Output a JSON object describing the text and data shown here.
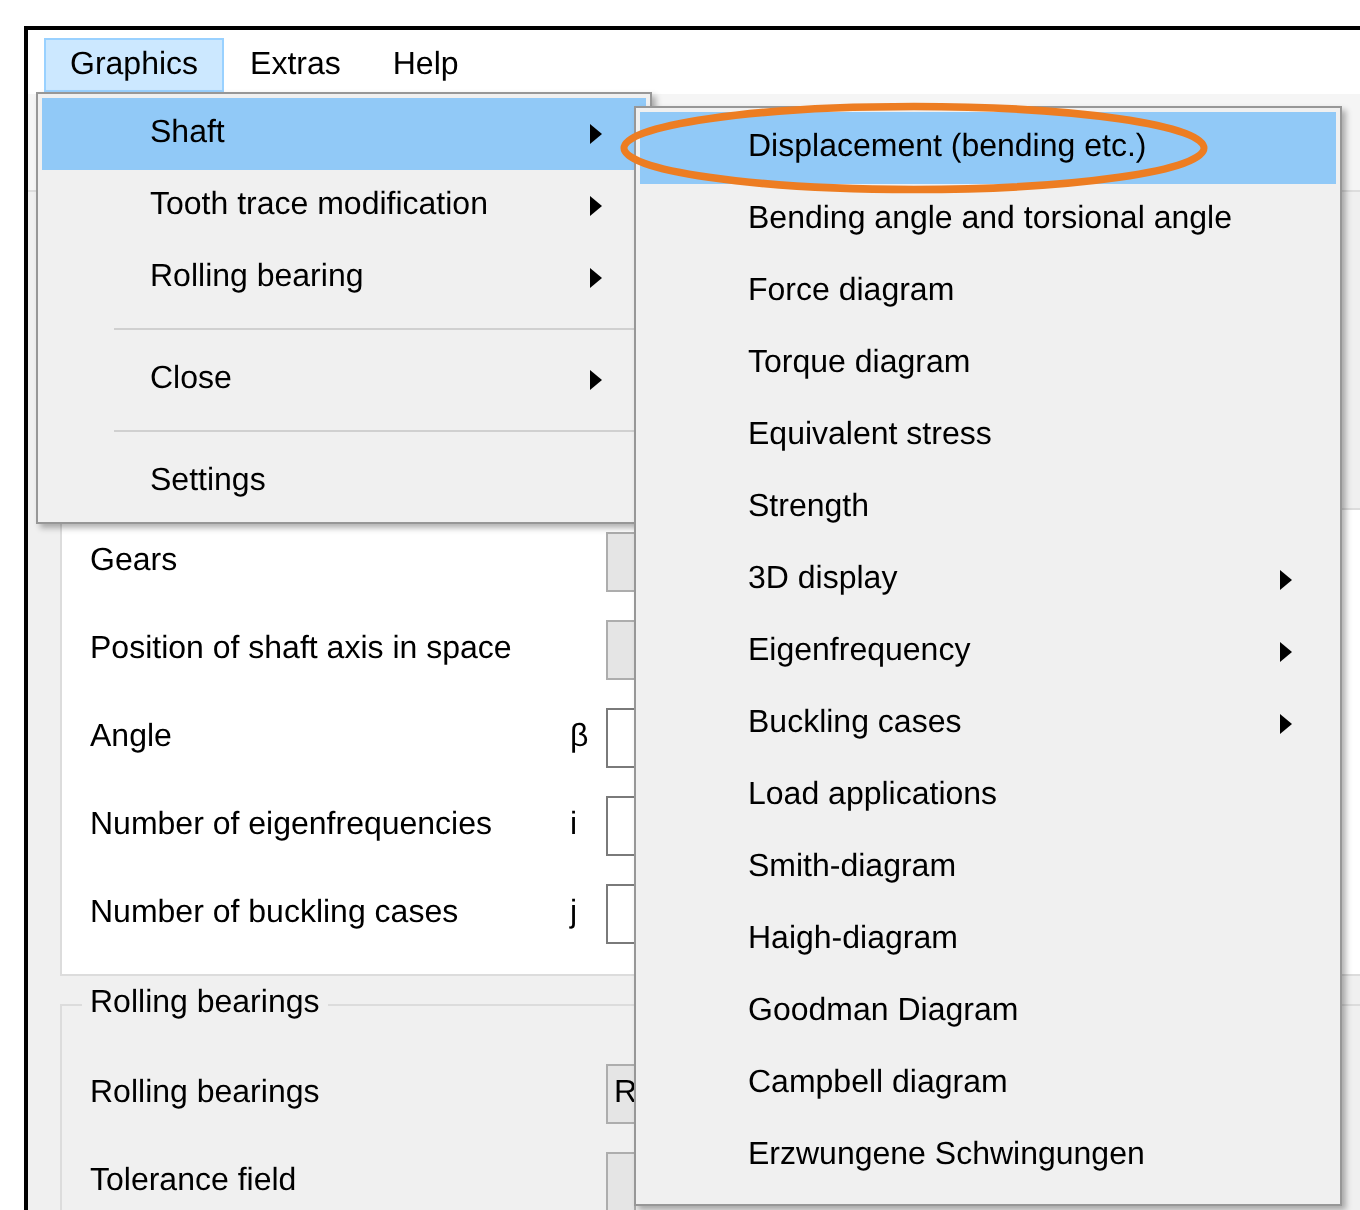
{
  "menubar": [
    {
      "label": "Graphics",
      "selected": true
    },
    {
      "label": "Extras",
      "selected": false
    },
    {
      "label": "Help",
      "selected": false
    }
  ],
  "graphics_menu": [
    {
      "kind": "item",
      "label": "Shaft",
      "submenu": true,
      "selected": true
    },
    {
      "kind": "item",
      "label": "Tooth trace modification",
      "submenu": true,
      "selected": false
    },
    {
      "kind": "item",
      "label": "Rolling bearing",
      "submenu": true,
      "selected": false
    },
    {
      "kind": "separator"
    },
    {
      "kind": "item",
      "label": "Close",
      "submenu": true,
      "selected": false
    },
    {
      "kind": "separator"
    },
    {
      "kind": "item",
      "label": "Settings",
      "submenu": false,
      "selected": false
    }
  ],
  "shaft_submenu": [
    {
      "label": "Displacement (bending etc.)",
      "submenu": false,
      "selected": true,
      "circled": true
    },
    {
      "label": "Bending angle and torsional angle",
      "submenu": false,
      "selected": false,
      "circled": false
    },
    {
      "label": "Force diagram",
      "submenu": false,
      "selected": false,
      "circled": false
    },
    {
      "label": "Torque diagram",
      "submenu": false,
      "selected": false,
      "circled": false
    },
    {
      "label": "Equivalent stress",
      "submenu": false,
      "selected": false,
      "circled": false
    },
    {
      "label": "Strength",
      "submenu": false,
      "selected": false,
      "circled": false
    },
    {
      "label": "3D display",
      "submenu": true,
      "selected": false,
      "circled": false
    },
    {
      "label": "Eigenfrequency",
      "submenu": true,
      "selected": false,
      "circled": false
    },
    {
      "label": "Buckling cases",
      "submenu": true,
      "selected": false,
      "circled": false
    },
    {
      "label": "Load applications",
      "submenu": false,
      "selected": false,
      "circled": false
    },
    {
      "label": "Smith-diagram",
      "submenu": false,
      "selected": false,
      "circled": false
    },
    {
      "label": "Haigh-diagram",
      "submenu": false,
      "selected": false,
      "circled": false
    },
    {
      "label": "Goodman Diagram",
      "submenu": false,
      "selected": false,
      "circled": false
    },
    {
      "label": "Campbell diagram",
      "submenu": false,
      "selected": false,
      "circled": false
    },
    {
      "label": "Erzwungene Schwingungen",
      "submenu": false,
      "selected": false,
      "circled": false
    }
  ],
  "settings_group": {
    "rows": [
      {
        "kind": "combo",
        "label": "Gears"
      },
      {
        "kind": "combo",
        "label": "Position of shaft axis in space"
      },
      {
        "kind": "input",
        "label": "Angle",
        "symbol": "β"
      },
      {
        "kind": "input",
        "label": "Number of eigenfrequencies",
        "symbol": "i"
      },
      {
        "kind": "input",
        "label": "Number of buckling cases",
        "symbol": "j"
      }
    ]
  },
  "rolling_bearings_group": {
    "title": "Rolling bearings",
    "rows": [
      {
        "kind": "combo",
        "label": "Rolling bearings",
        "value": "R"
      },
      {
        "kind": "combo",
        "label": "Tolerance field"
      }
    ]
  }
}
